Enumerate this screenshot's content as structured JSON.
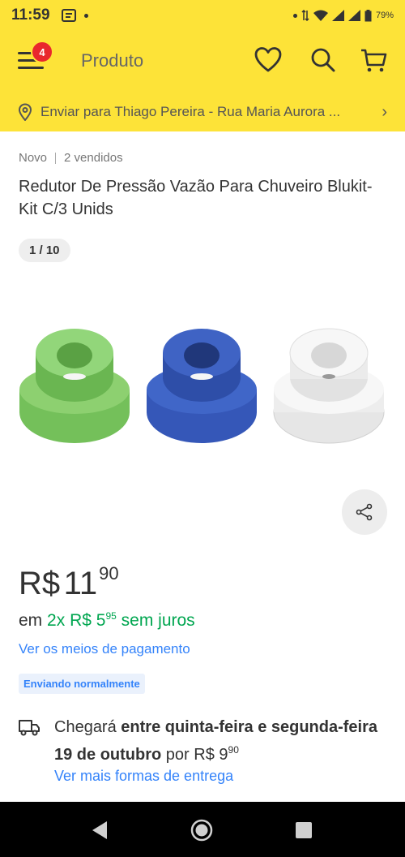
{
  "status_bar": {
    "time": "11:59",
    "battery": "79%"
  },
  "header": {
    "title": "Produto",
    "notification_count": "4"
  },
  "shipping_bar": {
    "text": "Enviar para Thiago Pereira - Rua Maria Aurora ..."
  },
  "product": {
    "condition": "Novo",
    "sold": "2 vendidos",
    "title": "Redutor De Pressão Vazão Para Chuveiro Blukit- Kit C/3 Unids",
    "image_counter": "1 / 10",
    "price_currency": "R$",
    "price_integer": "11",
    "price_cents": "90",
    "installments_prefix": "em",
    "installments_count": "2x",
    "installments_currency": "R$",
    "installments_integer": "5",
    "installments_cents": "95",
    "installments_suffix": "sem juros",
    "payment_link": "Ver os meios de pagamento",
    "shipping_tag": "Enviando normalmente"
  },
  "delivery": {
    "prefix": "Chegará",
    "strong": "entre quinta-feira e segunda-feira 19 de outubro",
    "middle": "por",
    "currency": "R$",
    "price_integer": "9",
    "price_cents": "90",
    "link": "Ver mais formas de entrega"
  },
  "gallery_colors": {
    "green": "#74c05a",
    "blue": "#3557b8",
    "white": "#f2f2f2"
  },
  "icons": [
    "menu-icon",
    "heart-icon",
    "search-icon",
    "cart-icon",
    "location-pin-icon",
    "chevron-right-icon",
    "share-icon",
    "truck-icon",
    "back-icon",
    "home-icon",
    "recents-icon"
  ]
}
